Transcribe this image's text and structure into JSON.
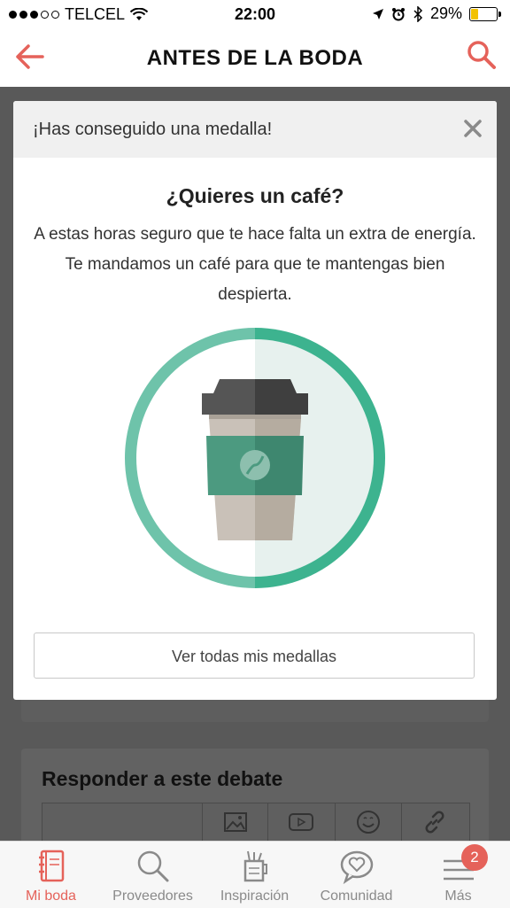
{
  "status_bar": {
    "carrier": "TELCEL",
    "time": "22:00",
    "battery": "29%",
    "battery_level": 0.29,
    "signal_bars": 3,
    "signal_total": 5
  },
  "nav": {
    "title": "ANTES DE LA BODA",
    "back_icon": "arrow-left-icon",
    "search_icon": "search-icon"
  },
  "modal": {
    "header": "¡Has conseguido una medalla!",
    "title": "¿Quieres un café?",
    "message": "A estas horas seguro que te hace falta un extra de energía. Te mandamos un café para que te mantengas bien despierta.",
    "button": "Ver todas mis medallas",
    "medal_icon": "coffee-cup-icon"
  },
  "background": {
    "reply_title": "Responder a este debate",
    "toolbar_icons": [
      "image-icon",
      "video-icon",
      "emoji-icon",
      "link-icon"
    ]
  },
  "tabs": [
    {
      "label": "Mi boda",
      "icon": "notebook-icon",
      "active": true
    },
    {
      "label": "Proveedores",
      "icon": "search-icon",
      "active": false
    },
    {
      "label": "Inspiración",
      "icon": "cup-icon",
      "active": false
    },
    {
      "label": "Comunidad",
      "icon": "chat-heart-icon",
      "active": false
    },
    {
      "label": "Más",
      "icon": "menu-icon",
      "active": false
    }
  ],
  "more_badge": "2",
  "colors": {
    "accent": "#e5625a",
    "medal_green": "#3db38f"
  }
}
